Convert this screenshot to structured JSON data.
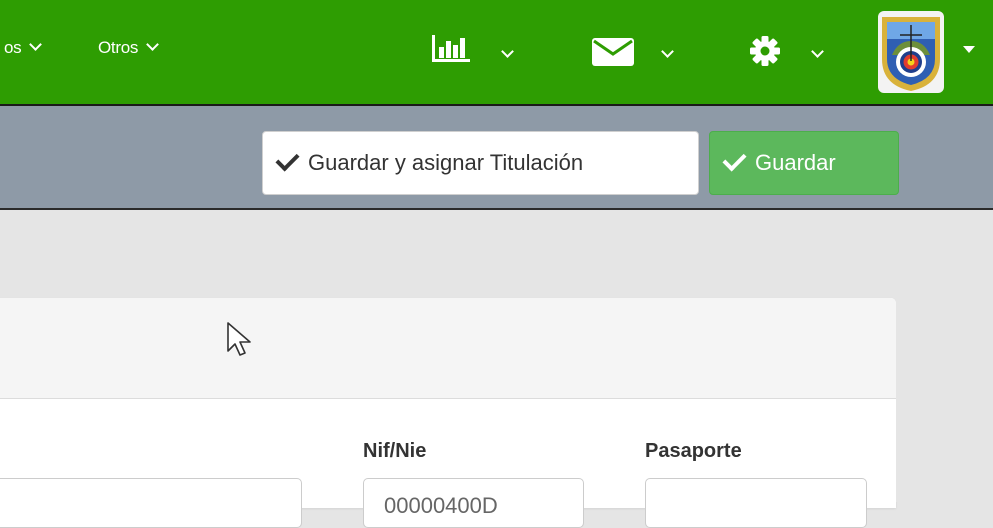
{
  "topbar": {
    "menu_partial": "os",
    "menu_otros": "Otros",
    "bg_color": "#2e9d02"
  },
  "icons": {
    "stats": "bar-chart-icon",
    "mail": "envelope-icon",
    "settings": "gear-icon",
    "avatar": "club-crest-avatar"
  },
  "toolbar": {
    "save_assign_label": "Guardar y asignar Titulación",
    "save_label": "Guardar",
    "success_color": "#5cb85c"
  },
  "form": {
    "nif_label": "Nif/Nie",
    "nif_value_partial": "00000400D",
    "passport_label": "Pasaporte"
  }
}
